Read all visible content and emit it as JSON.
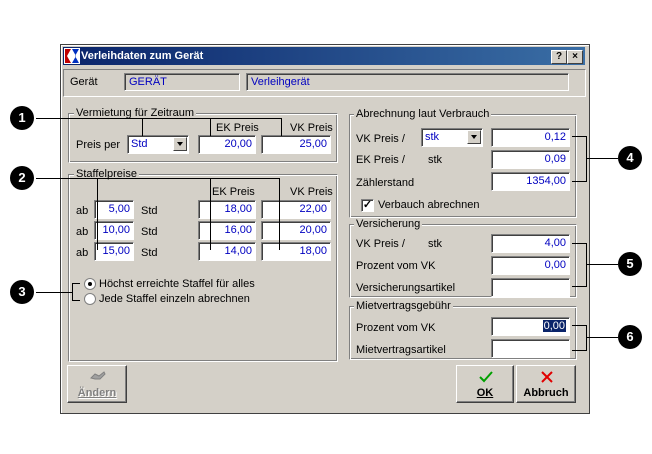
{
  "window": {
    "title": "Verleihdaten zum Gerät",
    "help_btn": "?",
    "close_btn": "×"
  },
  "device": {
    "label": "Gerät",
    "code": "GERÄT",
    "name": "Verleihgerät"
  },
  "rental": {
    "group_label": "Vermietung für Zeitraum",
    "price_per_label": "Preis per",
    "price_per_value": "Std",
    "ek_header": "EK Preis",
    "vk_header": "VK Preis",
    "ek_value": "20,00",
    "vk_value": "25,00"
  },
  "tiers": {
    "group_label": "Staffelpreise",
    "ek_header": "EK Preis",
    "vk_header": "VK Preis",
    "rows": [
      {
        "ab": "ab",
        "qty": "5,00",
        "unit": "Std",
        "ek": "18,00",
        "vk": "22,00"
      },
      {
        "ab": "ab",
        "qty": "10,00",
        "unit": "Std",
        "ek": "16,00",
        "vk": "20,00"
      },
      {
        "ab": "ab",
        "qty": "15,00",
        "unit": "Std",
        "ek": "14,00",
        "vk": "18,00"
      }
    ],
    "option_highest": "Höchst erreichte Staffel für alles",
    "option_each": "Jede Staffel einzeln abrechnen"
  },
  "usage": {
    "group_label": "Abrechnung laut Verbrauch",
    "vk_label": "VK Preis /",
    "vk_unit": "stk",
    "vk_value": "0,12",
    "ek_label": "EK Preis /",
    "ek_unit": "stk",
    "ek_value": "0,09",
    "meter_label": "Zählerstand",
    "meter_value": "1354,00",
    "checkbox_label": "Verbauch abrechnen"
  },
  "insurance": {
    "group_label": "Versicherung",
    "vk_label": "VK Preis /",
    "vk_unit": "stk",
    "vk_value": "4,00",
    "percent_label": "Prozent vom VK",
    "percent_value": "0,00",
    "article_label": "Versicherungsartikel",
    "article_value": ""
  },
  "contract": {
    "group_label": "Mietvertragsgebühr",
    "percent_label": "Prozent vom VK",
    "percent_value": "0,00",
    "article_label": "Mietvertragsartikel",
    "article_value": ""
  },
  "buttons": {
    "edit": "Ändern",
    "ok": "OK",
    "cancel": "Abbruch"
  },
  "callouts": [
    "1",
    "2",
    "3",
    "4",
    "5",
    "6"
  ],
  "colors": {
    "title_start": "#0a246a",
    "title_end": "#3a6ea5",
    "value_text": "#0000c0",
    "dialog_bg": "#d4d0c8"
  }
}
